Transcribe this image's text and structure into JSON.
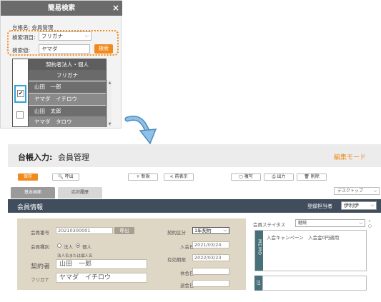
{
  "quick_search": {
    "title": "簡易検索",
    "close_icon": "×",
    "ledger_label": "台帳名: 会員管理",
    "item_label": "検索項目:",
    "item_value": "フリガナ",
    "value_label": "検索値:",
    "value_input": "ヤマダ",
    "search_button": "検索",
    "table_header_1": "契約者法人・個人",
    "table_header_2": "フリガナ",
    "results": [
      {
        "name": "山田　一郎",
        "kana": "ヤマダ　イチロウ",
        "checked": true
      },
      {
        "name": "山田　太郎",
        "kana": "ヤマダ　タロウ",
        "checked": false
      }
    ],
    "highlight_color": "#ef8a1c"
  },
  "member_screen": {
    "title_prefix": "台帳入力:",
    "title": "会員管理",
    "mode": "編集モード",
    "toolbar": {
      "save": "保存",
      "call": "🔍 呼出",
      "new": "+ 新規",
      "prev": "< 前表示",
      "copy": "▢ 複写",
      "print": "⎙ 出力",
      "delete": "🗑 削除"
    },
    "tabs": [
      "基本画面",
      "応対履歴"
    ],
    "view_select": "デスクトップ",
    "section_title": "会員情報",
    "owner_label": "登録担当者",
    "owner_value": "伊利伊",
    "form": {
      "member_no_label": "会員番号",
      "member_no": "20210300001",
      "call_button": "呼出",
      "type_label": "会員種別",
      "type_corp": "法人",
      "type_individual": "個人",
      "name_hint": "法人名または個人名",
      "contractor_label": "契約者",
      "contractor_value": "山田　一郎",
      "kana_label": "フリガナ",
      "kana_value": "ヤマダ　イチロウ",
      "contract_type_label": "契約区分",
      "contract_type_value": "1年契約",
      "join_date_label": "入会日",
      "join_date": "2021/03/24",
      "expire_label": "有効期限",
      "expire_date": "2022/03/23",
      "suspend_label": "休会日",
      "withdraw_label": "退会日"
    },
    "status_label": "会員ステイタス",
    "status_value": "継続",
    "memo_side": "MEMO",
    "memo_text": "入会キャンペーン　入会金0円適用",
    "note_side": "注"
  }
}
